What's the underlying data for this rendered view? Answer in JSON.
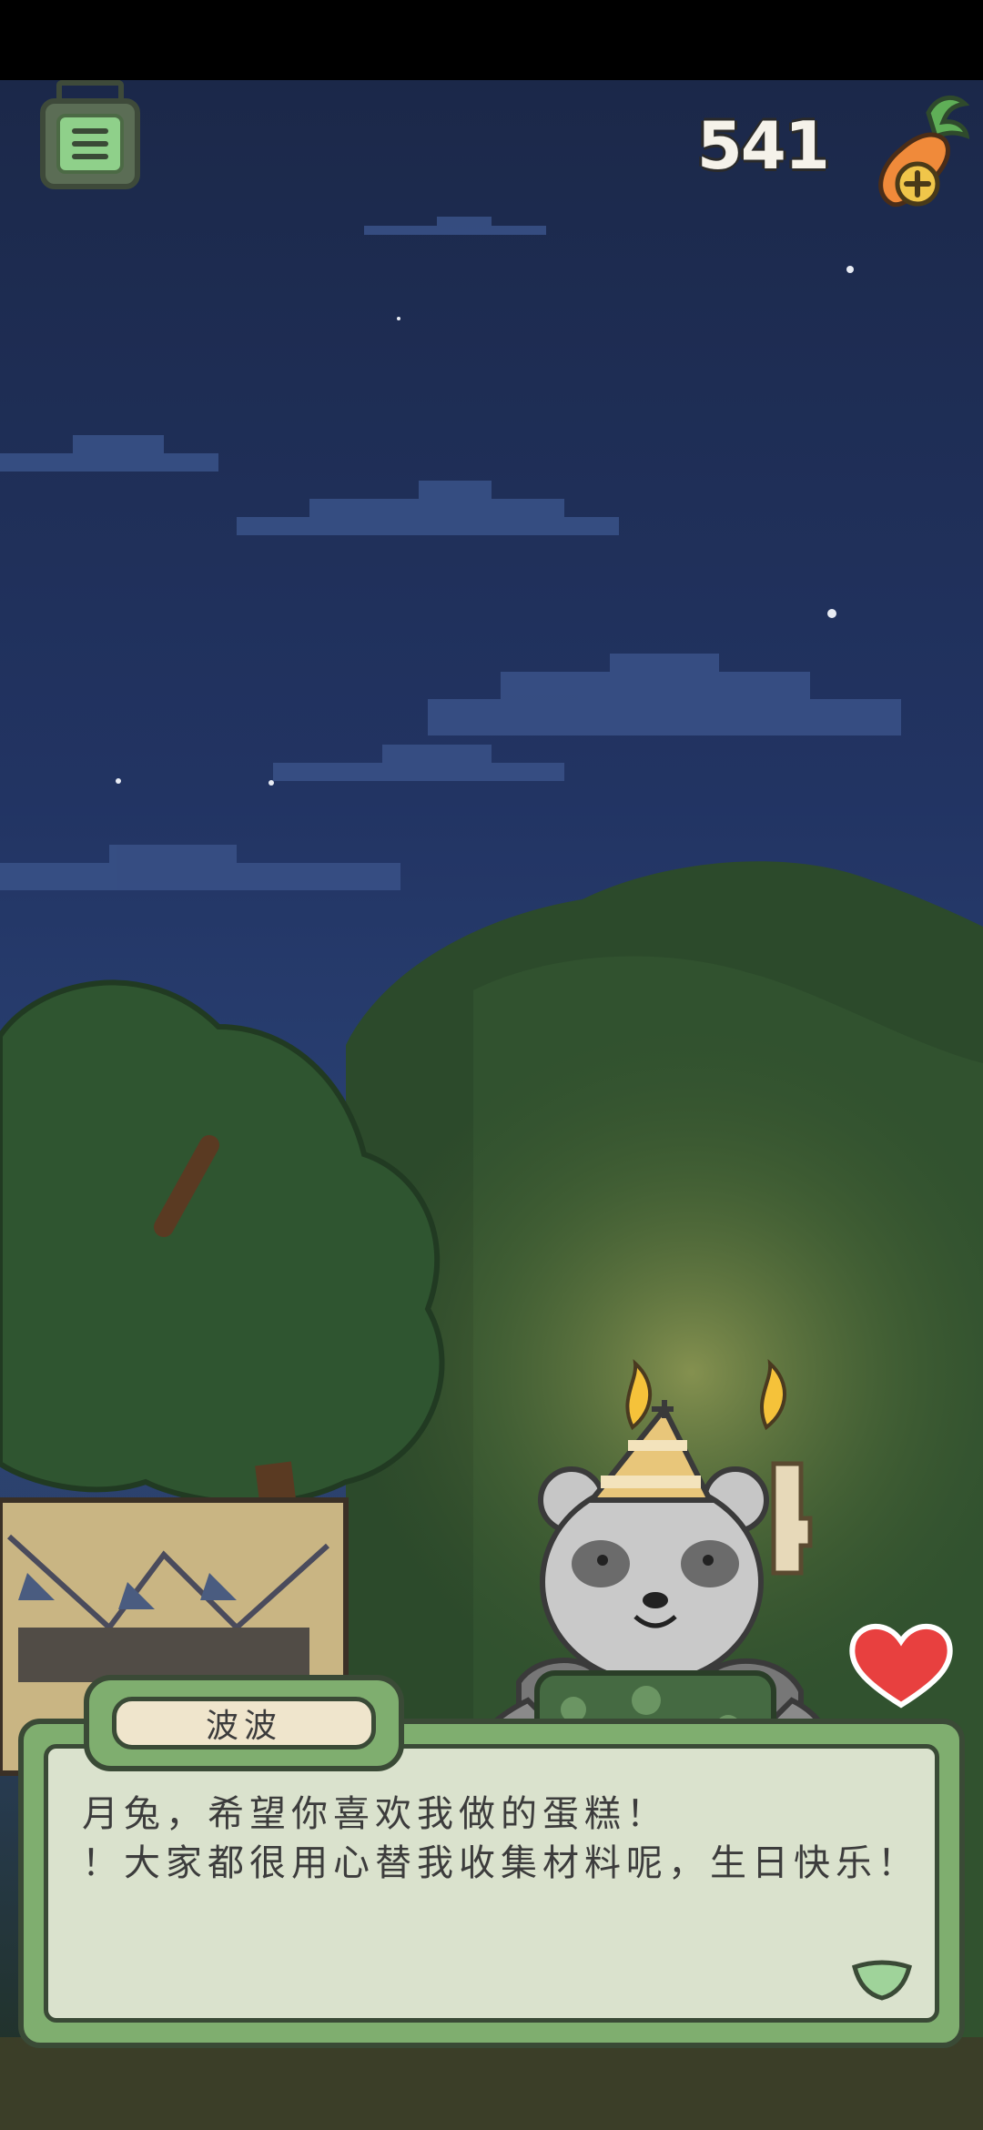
{
  "hud": {
    "menu_icon": "menu-list-icon",
    "carrot_count": "541",
    "carrot_icon": "carrot-add-icon"
  },
  "character": {
    "name": "波波",
    "icon": "panda-party-hat"
  },
  "dialog": {
    "line1": "月兔，希望你喜欢我做的蛋糕！",
    "line2": "！大家都很用心替我收集材料呢，生日快乐！",
    "next_icon": "next-arrow-icon"
  },
  "decor": {
    "heart_icon": "heart-icon",
    "cake_number": "4"
  },
  "colors": {
    "sky_top": "#1b2849",
    "sky_mid": "#2c4579",
    "dialog_green": "#7fae6f",
    "outline": "#3a4a36",
    "heart_red": "#e8403f"
  }
}
